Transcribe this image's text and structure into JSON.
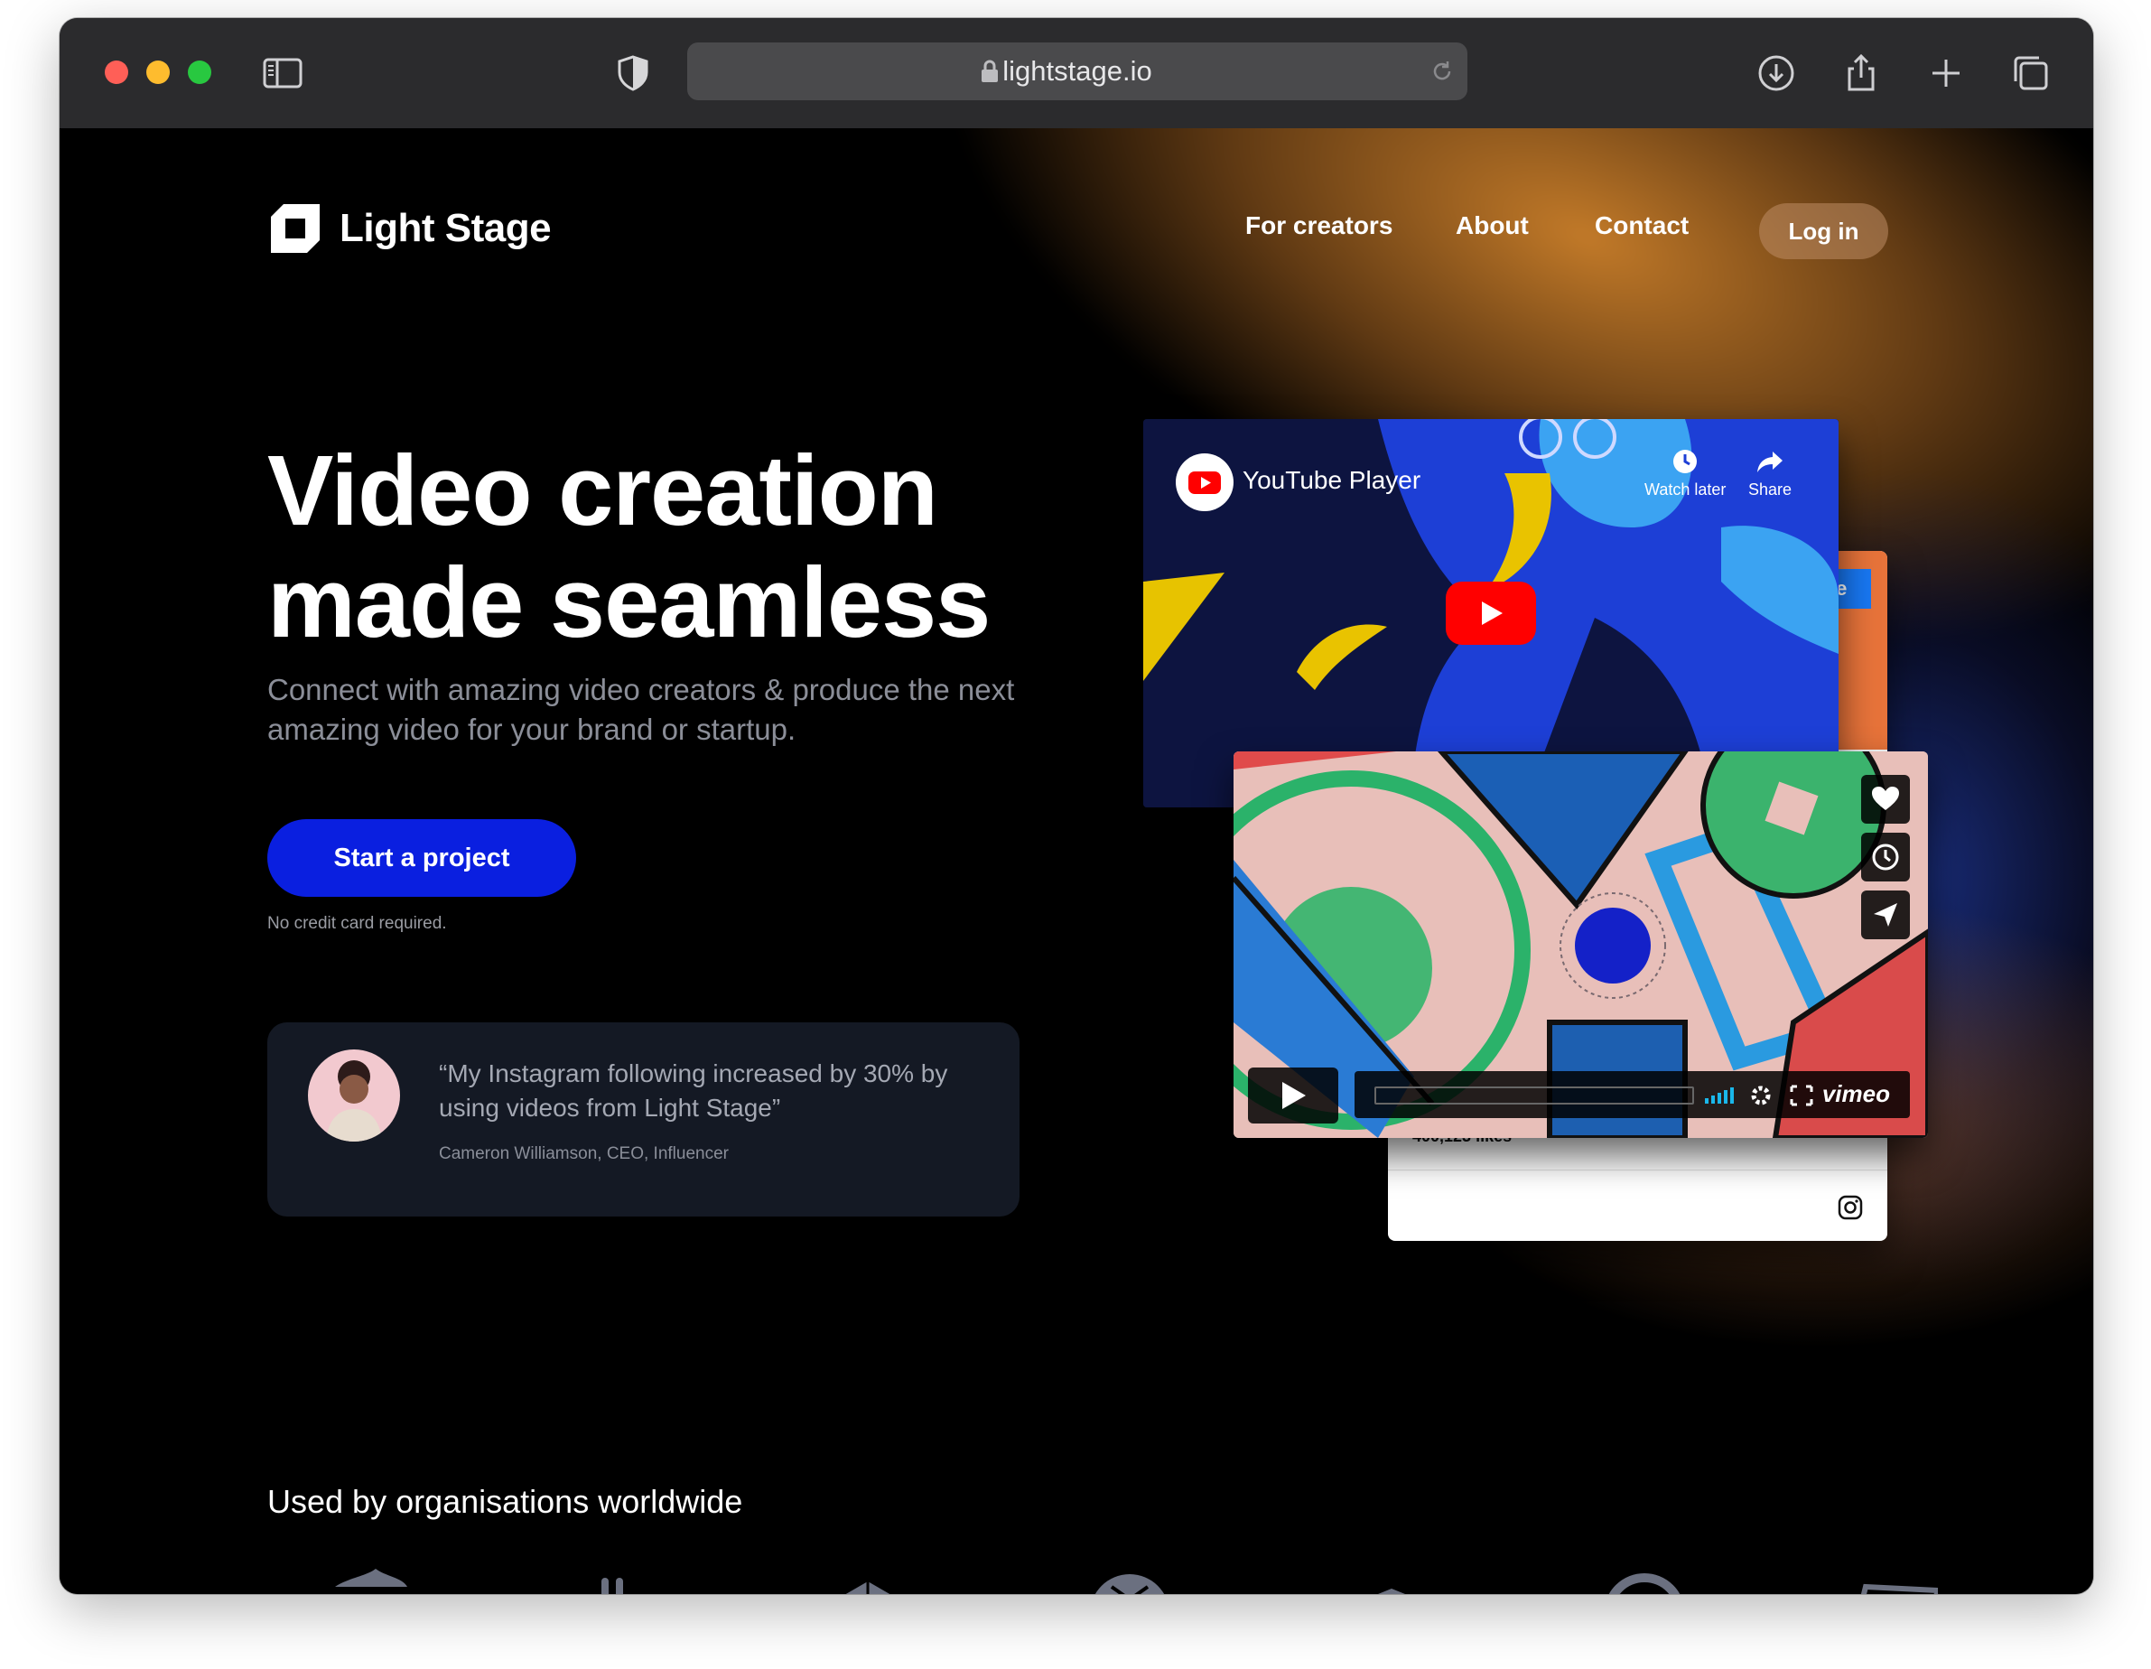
{
  "browser": {
    "url": "lightstage.io"
  },
  "site": {
    "brand": "Light Stage",
    "nav": [
      "For creators",
      "About",
      "Contact"
    ],
    "login_label": "Log in"
  },
  "hero": {
    "title_line1": "Video creation",
    "title_line2": "made seamless",
    "subtitle": "Connect with amazing video creators & produce the next amazing video for your brand or startup.",
    "cta_label": "Start a project",
    "cta_note": "No credit card required."
  },
  "testimonial": {
    "quote": "“My Instagram following increased by 30% by using videos from Light Stage”",
    "author": "Cameron Williamson, CEO, Influencer"
  },
  "mockups": {
    "youtube": {
      "title": "YouTube Player",
      "watch_later": "Watch later",
      "share": "Share"
    },
    "instagram": {
      "likes": "400,123 likes",
      "button_partial": "le"
    },
    "vimeo": {
      "brand": "vimeo"
    }
  },
  "orgs": {
    "heading": "Used by organisations worldwide",
    "logos": [
      "twitter-icon",
      "dots-icon",
      "book-icon",
      "mail-icon",
      "cap-icon",
      "circle-icon",
      "box-icon"
    ]
  },
  "colors": {
    "cta": "#0a1fe0",
    "accent_orange": "#c8802f",
    "toolbar": "#2b2b2d"
  }
}
